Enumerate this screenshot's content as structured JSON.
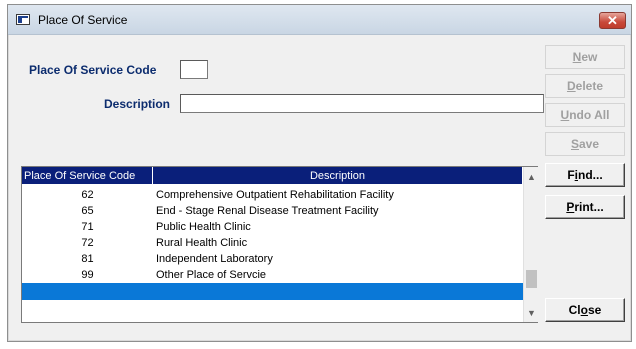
{
  "window": {
    "title": "Place Of Service",
    "close_glyph": "✕"
  },
  "form": {
    "code_label": "Place Of Service Code",
    "code_value": "",
    "description_label": "Description",
    "description_value": ""
  },
  "buttons": [
    {
      "pre": "",
      "key": "N",
      "post": "ew",
      "enabled": false
    },
    {
      "pre": "",
      "key": "D",
      "post": "elete",
      "enabled": false
    },
    {
      "pre": "",
      "key": "U",
      "post": "ndo All",
      "enabled": false
    },
    {
      "pre": "",
      "key": "S",
      "post": "ave",
      "enabled": false
    },
    {
      "pre": "F",
      "key": "i",
      "post": "nd...",
      "enabled": true
    },
    {
      "pre": "",
      "key": "P",
      "post": "rint...",
      "enabled": true
    },
    {
      "pre": "Cl",
      "key": "o",
      "post": "se",
      "enabled": true
    }
  ],
  "grid": {
    "columns": [
      "Place Of Service Code",
      "Description"
    ],
    "rows": [
      {
        "code": "62",
        "description": "Comprehensive Outpatient Rehabilitation Facility"
      },
      {
        "code": "65",
        "description": "End - Stage Renal Disease Treatment Facility"
      },
      {
        "code": "71",
        "description": "Public Health Clinic"
      },
      {
        "code": "72",
        "description": "Rural Health Clinic"
      },
      {
        "code": "81",
        "description": "Independent Laboratory"
      },
      {
        "code": "99",
        "description": "Other Place of Servcie"
      },
      {
        "code": "",
        "description": ""
      }
    ],
    "selected_row_index": 6,
    "scroll_up_glyph": "▲",
    "scroll_down_glyph": "▼"
  },
  "colors": {
    "header_bg": "#0a1f7a",
    "selection": "#0a78d7",
    "label_text": "#0c2c6e",
    "close_button": "#c8493a"
  }
}
